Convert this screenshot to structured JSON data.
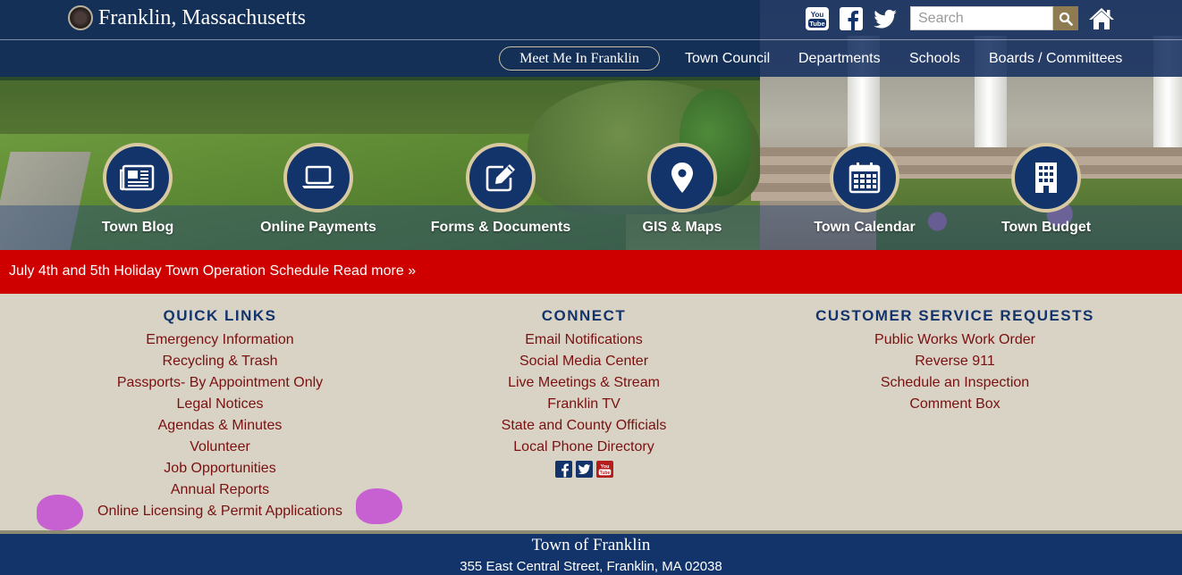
{
  "header": {
    "site_title": "Franklin, Massachusetts",
    "search_placeholder": "Search",
    "icons": [
      "youtube-icon",
      "facebook-icon",
      "twitter-icon",
      "search-icon",
      "home-icon"
    ]
  },
  "nav": {
    "pill": "Meet Me In Franklin",
    "items": [
      "Town Council",
      "Departments",
      "Schools",
      "Boards / Committees"
    ]
  },
  "quick_links": [
    {
      "label": "Town Blog",
      "icon": "newspaper-icon"
    },
    {
      "label": "Online Payments",
      "icon": "laptop-icon"
    },
    {
      "label": "Forms & Documents",
      "icon": "edit-document-icon"
    },
    {
      "label": "GIS & Maps",
      "icon": "map-pin-icon"
    },
    {
      "label": "Town Calendar",
      "icon": "calendar-icon"
    },
    {
      "label": "Town Budget",
      "icon": "building-icon"
    }
  ],
  "alert": {
    "text": "July 4th and 5th Holiday Town Operation Schedule Read more »"
  },
  "columns": {
    "quick": {
      "heading": "QUICK LINKS",
      "links": [
        "Emergency Information",
        "Recycling & Trash",
        "Passports- By Appointment Only",
        "Legal Notices",
        "Agendas & Minutes",
        "Volunteer",
        "Job Opportunities",
        "Annual Reports",
        "Online Licensing & Permit Applications"
      ]
    },
    "connect": {
      "heading": "CONNECT",
      "links": [
        "Email Notifications",
        "Social Media Center",
        "Live Meetings & Stream",
        "Franklin TV",
        "State and County Officials",
        "Local Phone Directory"
      ]
    },
    "service": {
      "heading": "CUSTOMER SERVICE REQUESTS",
      "links": [
        "Public Works Work Order",
        "Reverse 911",
        "Schedule an Inspection",
        "Comment Box"
      ]
    }
  },
  "footer": {
    "title": "Town of Franklin",
    "address": "355 East Central Street, Franklin, MA 02038"
  },
  "colors": {
    "navy": "#13346b",
    "alert_red": "#cf0000",
    "link_maroon": "#7a1010",
    "panel_beige": "#d9d3c5",
    "search_gold": "#8e7b52"
  }
}
